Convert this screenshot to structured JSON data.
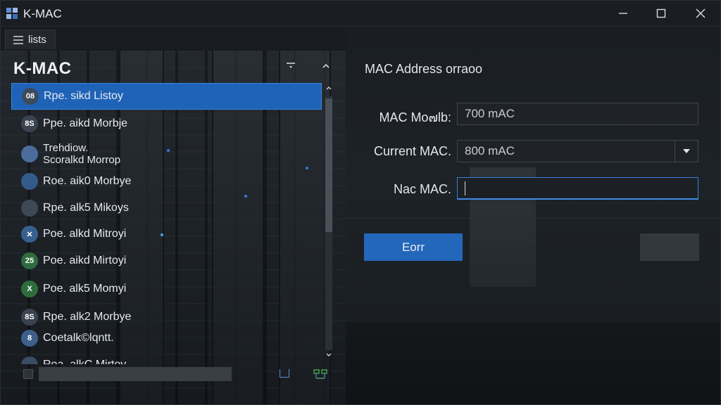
{
  "window": {
    "title": "K-MAC"
  },
  "tabstrip": {
    "tab_label": "lists"
  },
  "list_pane": {
    "title": "K-MAC",
    "items": [
      {
        "label": "Rpe. sikd Listoy",
        "badge": "08",
        "icon": "network-adapter-icon",
        "color": "#3c4a5c",
        "selected": true
      },
      {
        "label": "Ppe. aikd Morbje",
        "badge": "8S",
        "icon": "network-adapter-icon",
        "color": "#3a4350",
        "selected": false
      },
      {
        "label": "Trehdiow.",
        "label2": "Scoralkd Morrop",
        "badge": "",
        "icon": "shield-icon",
        "color": "#4b6d9c",
        "selected": false
      },
      {
        "label": "Roe. aik0 Morbye",
        "badge": "",
        "icon": "network-adapter-icon",
        "color": "#345a8c",
        "selected": false
      },
      {
        "label": "Rpe. alk5 Mikoys",
        "badge": "",
        "icon": "network-adapter-icon",
        "color": "#3e4955",
        "selected": false
      },
      {
        "label": "Poe. alkd Mitroyi",
        "badge": "✕",
        "icon": "network-adapter-icon",
        "color": "#36608e",
        "selected": false
      },
      {
        "label": "Poe. aikd Mirtoyi",
        "badge": "25",
        "icon": "network-adapter-icon",
        "color": "#2f6b3e",
        "selected": false
      },
      {
        "label": "Poe. alk5 Momyi",
        "badge": "X",
        "icon": "network-adapter-icon",
        "color": "#2e6d3b",
        "selected": false
      },
      {
        "label": "Rpe. alk2 Morbye",
        "badge": "8S",
        "icon": "network-adapter-icon",
        "color": "#3a4350",
        "selected": false
      },
      {
        "label": "Coetalk©lqntt.",
        "badge": "8",
        "icon": "network-adapter-icon",
        "color": "#3e5f8a",
        "selected": false
      },
      {
        "label": "Roa. alkC Mirtoy",
        "badge": "",
        "icon": "network-adapter-icon",
        "color": "#3a4d66",
        "selected": false
      }
    ]
  },
  "form": {
    "section_title": "MAC Address orraoo",
    "mac_model_label": "MAC Mo๗lb:",
    "mac_model_value": "700 mAC",
    "current_mac_label": "Current MAC.",
    "current_mac_value": "800 mAC",
    "new_mac_label": "Nac MAC.",
    "new_mac_value": "",
    "primary_button": "Eorr"
  },
  "colors": {
    "accent": "#1f63b8",
    "focus": "#3f8ae6"
  }
}
